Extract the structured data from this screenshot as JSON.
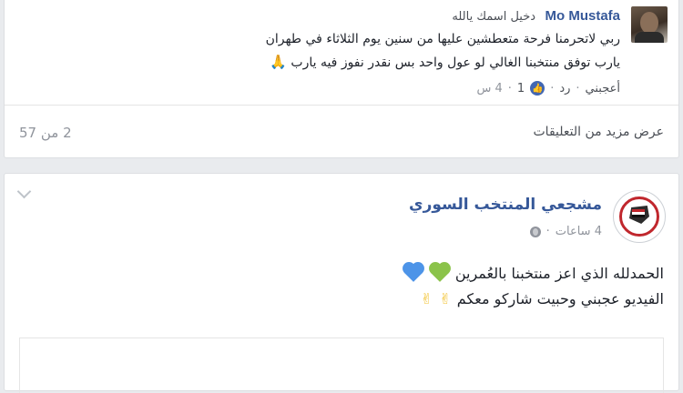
{
  "comment": {
    "author": "Mo Mustafa",
    "subtitle": "دخيل اسمك يالله",
    "line1": "ربي لاتحرمنا فرحة متعطشين عليها من سنين يوم الثلاثاء في طهران",
    "line2": "يارب توفق منتخبنا الغالي لو عول واحد بس نقدر نفوز فيه يارب",
    "emoji_icon": "folded-hands-emoji",
    "like_label": "أعجبني",
    "separator": "·",
    "reply_label": "رد",
    "like_count": "1",
    "time": "4 س"
  },
  "more_comments": {
    "label": "عرض مزيد من التعليقات",
    "count": "2 من 57"
  },
  "post": {
    "author": "مشجعي المنتخب السوري",
    "time": "4 ساعات",
    "line1_text": "الحمدلله الذي اعز منتخبنا بالعُمرين",
    "line2_text": "الفيديو عجبني وحبيت شاركو معكم",
    "colors": {
      "heart_green": "#8bc34a",
      "heart_blue": "#4d94e8",
      "link": "#365899"
    }
  }
}
